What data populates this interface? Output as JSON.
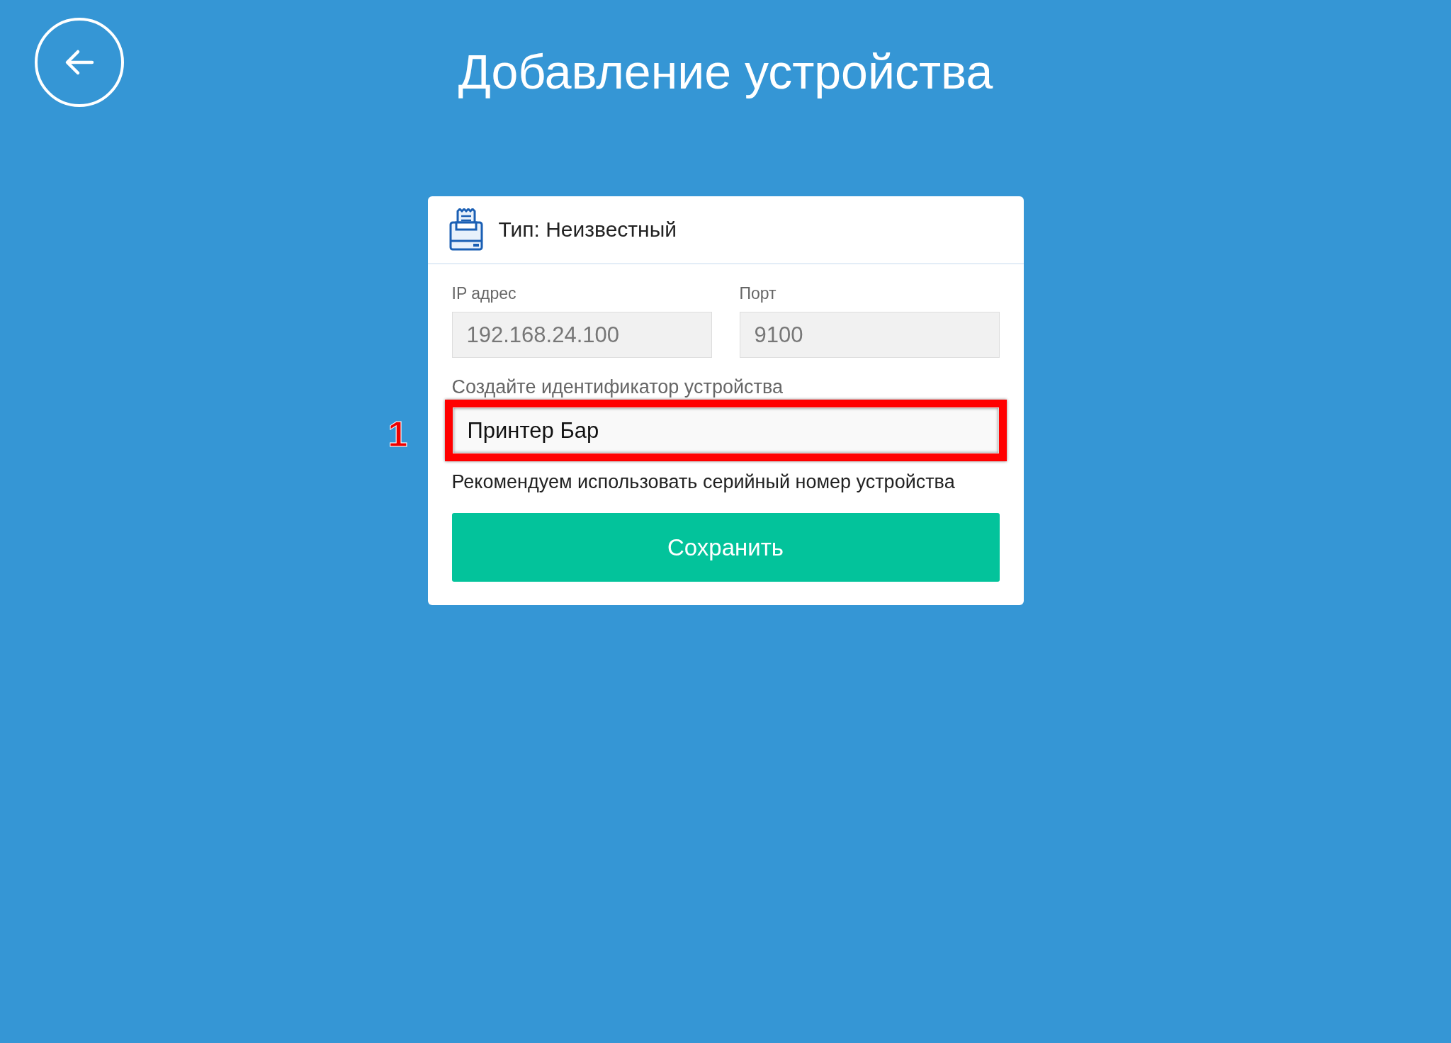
{
  "header": {
    "title": "Добавление устройства"
  },
  "card": {
    "type_label": "Тип: Неизвестный",
    "fields": [
      {
        "label": "IP адрес",
        "value": "192.168.24.100",
        "disabled": true
      },
      {
        "label": "Порт",
        "value": "9100",
        "disabled": true
      }
    ],
    "identifier": {
      "label": "Создайте идентификатор устройства",
      "value": "Принтер Бар",
      "disabled": false,
      "highlighted": true,
      "annotation": "1"
    },
    "hint": "Рекомендуем использовать серийный номер устройства",
    "save_button": "Сохранить"
  }
}
